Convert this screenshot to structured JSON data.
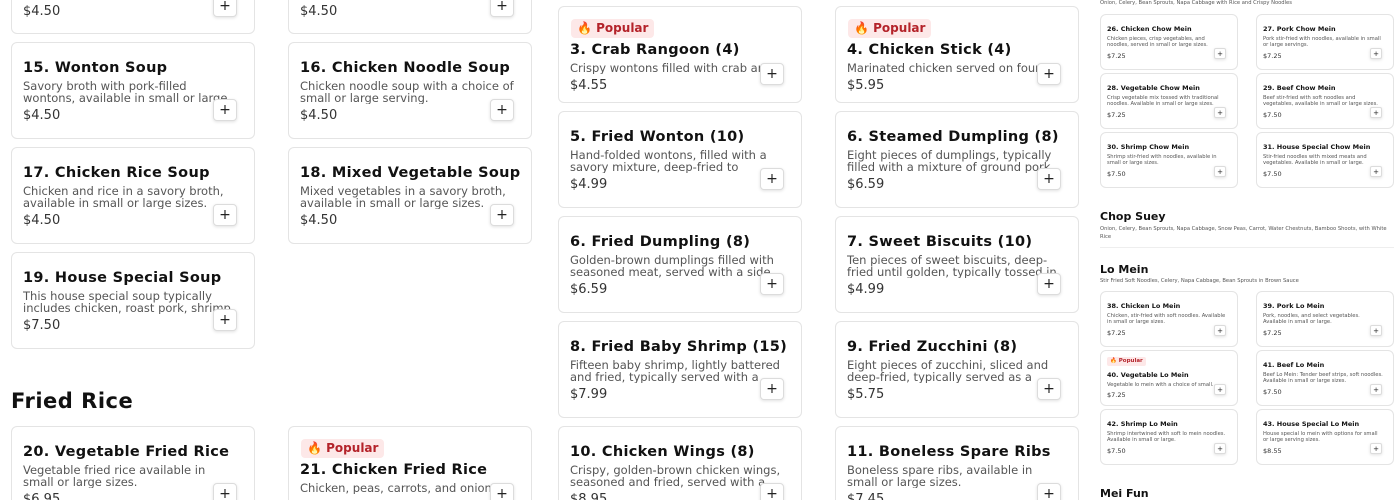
{
  "add_label": "+",
  "popular_label": "Popular",
  "popular_icon": "fire-icon",
  "colors": {
    "badge_bg": "#fde8e8",
    "badge_text": "#b4232a",
    "border": "#e4e4e4"
  },
  "top_prices": {
    "a": "$4.50",
    "b": "$4.50"
  },
  "soups": [
    {
      "title": "15. Wonton Soup",
      "desc": "Savory broth with pork-filled wontons, available in small or large sizes.",
      "price": "$4.50"
    },
    {
      "title": "16. Chicken Noodle Soup",
      "desc": "Chicken noodle soup with a choice of small or large serving.",
      "price": "$4.50"
    },
    {
      "title": "17. Chicken Rice Soup",
      "desc": "Chicken and rice in a savory broth, available in small or large sizes.",
      "price": "$4.50"
    },
    {
      "title": "18. Mixed Vegetable Soup",
      "desc": "Mixed vegetables in a savory broth, available in small or large sizes.",
      "price": "$4.50"
    },
    {
      "title": "19. House Special Soup",
      "desc": "This house special soup typically includes chicken, roast pork, shrimp, and a variety ...",
      "price": "$7.50"
    }
  ],
  "fried_rice_heading": "Fried Rice",
  "fried_rice": [
    {
      "title": "20. Vegetable Fried Rice",
      "desc": "Vegetable fried rice available in small or large sizes.",
      "price": "$6.95"
    },
    {
      "title": "21. Chicken Fried Rice",
      "desc": "Chicken, peas, carrots, and onions in fr...",
      "price": ""
    }
  ],
  "appetizers": [
    {
      "title": "3. Crab Rangoon (4)",
      "desc": "Crispy wontons filled with crab and cre...",
      "price": "$4.55"
    },
    {
      "title": "4. Chicken Stick (4)",
      "desc": "Marinated chicken served on four skew...",
      "price": "$5.95"
    },
    {
      "title": "5. Fried Wonton (10)",
      "desc": "Hand-folded wontons, filled with a savory mixture, deep-fried to achieve a golden ...",
      "price": "$4.99"
    },
    {
      "title": "6. Steamed Dumpling (8)",
      "desc": "Eight pieces of dumplings, typically filled with a mixture of ground pork and...",
      "price": "$6.59"
    },
    {
      "title": "6. Fried Dumpling (8)",
      "desc": "Golden-brown dumplings filled with seasoned meat, served with a side of tan...",
      "price": "$6.59"
    },
    {
      "title": "7. Sweet Biscuits (10)",
      "desc": "Ten pieces of sweet biscuits, deep-fried until golden, typically tossed in sugar for...",
      "price": "$4.99"
    },
    {
      "title": "8. Fried Baby Shrimp (15)",
      "desc": "Fifteen baby shrimp, lightly battered and fried, typically served with a sweet and so...",
      "price": "$7.99"
    },
    {
      "title": "9. Fried Zucchini (8)",
      "desc": "Eight pieces of zucchini, sliced and deep-fried, typically served as a crispy appetizer.",
      "price": "$5.75"
    },
    {
      "title": "10. Chicken Wings (8)",
      "desc": "Crispy, golden-brown chicken wings, seasoned and fried, served with a side of...",
      "price": "$8.95"
    },
    {
      "title": "11. Boneless Spare Ribs",
      "desc": "Boneless spare ribs, available in small or large sizes.",
      "price": "$7.45"
    }
  ],
  "right": {
    "top_subtitle": "Onion, Celery, Bean Sprouts, Napa Cabbage with Rice and Crispy Noodles",
    "chow_mein": [
      {
        "title": "26. Chicken Chow Mein",
        "desc": "Chicken pieces, crisp vegetables, and noodles, served in small or large sizes.",
        "price": "$7.25"
      },
      {
        "title": "27. Pork Chow Mein",
        "desc": "Pork stir-fried with noodles, available in small or large servings.",
        "price": "$7.25"
      },
      {
        "title": "28. Vegetable Chow Mein",
        "desc": "Crisp vegetable mix tossed with traditional noodles. Available in small or large sizes.",
        "price": "$7.25"
      },
      {
        "title": "29. Beef Chow Mein",
        "desc": "Beef stir-fried with soft noodles and vegetables, available in small or large sizes.",
        "price": "$7.50"
      },
      {
        "title": "30. Shrimp Chow Mein",
        "desc": "Shrimp stir-fried with noodles, available in small or large sizes.",
        "price": "$7.50"
      },
      {
        "title": "31. House Special Chow Mein",
        "desc": "Stir-fried noodles with mixed meats and vegetables. Available in small or large.",
        "price": "$7.50"
      }
    ],
    "chop_suey_heading": "Chop Suey",
    "chop_suey_sub": "Onion, Celery, Bean Sprouts, Napa Cabbage, Snow Peas, Carrot, Water Chestnuts, Bamboo Shoots, with White Rice",
    "lo_mein_heading": "Lo Mein",
    "lo_mein_sub": "Stir Fried Soft Noodles, Celery, Napa Cabbage, Bean Sprouts in Brown Sauce",
    "lo_mein": [
      {
        "title": "38. Chicken Lo Mein",
        "desc": "Chicken, stir-fried with soft noodles. Available in small or large sizes.",
        "price": "$7.25"
      },
      {
        "title": "39. Pork Lo Mein",
        "desc": "Pork, noodles, and select vegetables. Available in small or large.",
        "price": "$7.25"
      },
      {
        "title": "40. Vegetable Lo Mein",
        "desc": "Vegetable lo mein with a choice of small...",
        "price": "$7.25"
      },
      {
        "title": "41. Beef Lo Mein",
        "desc": "Beef Lo Mein: Tender beef strips, soft noodles. Available in small or large sizes.",
        "price": "$7.50"
      },
      {
        "title": "42. Shrimp Lo Mein",
        "desc": "Shrimp intertwined with soft lo mein noodles. Available in small or large.",
        "price": "$7.50"
      },
      {
        "title": "43. House Special Lo Mein",
        "desc": "House special lo mein with options for small or large serving sizes.",
        "price": "$8.55"
      }
    ],
    "mei_fun_heading": "Mei Fun"
  }
}
